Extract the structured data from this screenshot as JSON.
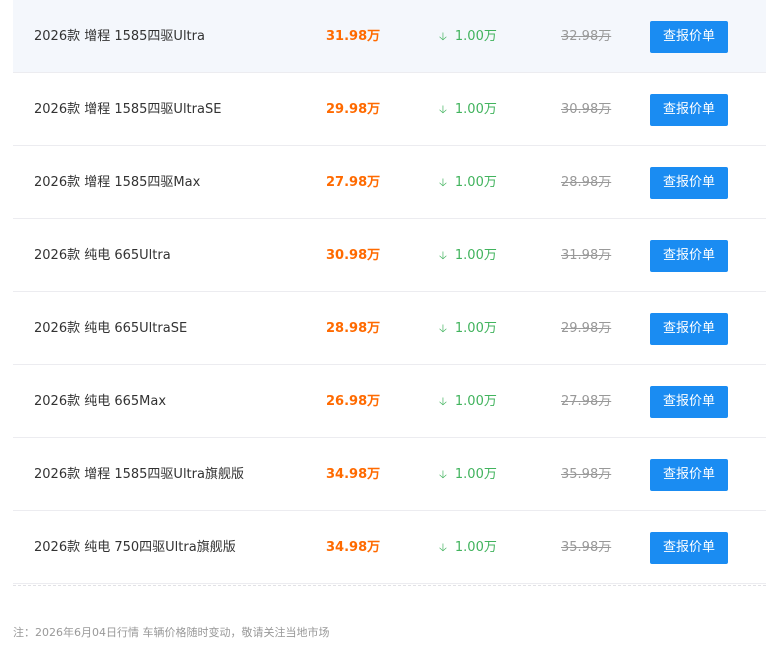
{
  "rows": [
    {
      "model": "2026款 增程 1585四驱Ultra",
      "price": "31.98万",
      "drop": "1.00万",
      "old_price": "32.98万",
      "button": "查报价单"
    },
    {
      "model": "2026款 增程 1585四驱UltraSE",
      "price": "29.98万",
      "drop": "1.00万",
      "old_price": "30.98万",
      "button": "查报价单"
    },
    {
      "model": "2026款 增程 1585四驱Max",
      "price": "27.98万",
      "drop": "1.00万",
      "old_price": "28.98万",
      "button": "查报价单"
    },
    {
      "model": "2026款 纯电 665Ultra",
      "price": "30.98万",
      "drop": "1.00万",
      "old_price": "31.98万",
      "button": "查报价单"
    },
    {
      "model": "2026款 纯电 665UltraSE",
      "price": "28.98万",
      "drop": "1.00万",
      "old_price": "29.98万",
      "button": "查报价单"
    },
    {
      "model": "2026款 纯电 665Max",
      "price": "26.98万",
      "drop": "1.00万",
      "old_price": "27.98万",
      "button": "查报价单"
    },
    {
      "model": "2026款 增程 1585四驱Ultra旗舰版",
      "price": "34.98万",
      "drop": "1.00万",
      "old_price": "35.98万",
      "button": "查报价单"
    },
    {
      "model": "2026款 纯电 750四驱Ultra旗舰版",
      "price": "34.98万",
      "drop": "1.00万",
      "old_price": "35.98万",
      "button": "查报价单"
    }
  ],
  "icons": {
    "drop": "down-arrow-icon"
  },
  "colors": {
    "price": "#ff6a00",
    "drop": "#41b35d",
    "button": "#1a8cf2",
    "old_price": "#999999"
  },
  "note": "注：2026年6月04日行情 车辆价格随时变动，敬请关注当地市场"
}
